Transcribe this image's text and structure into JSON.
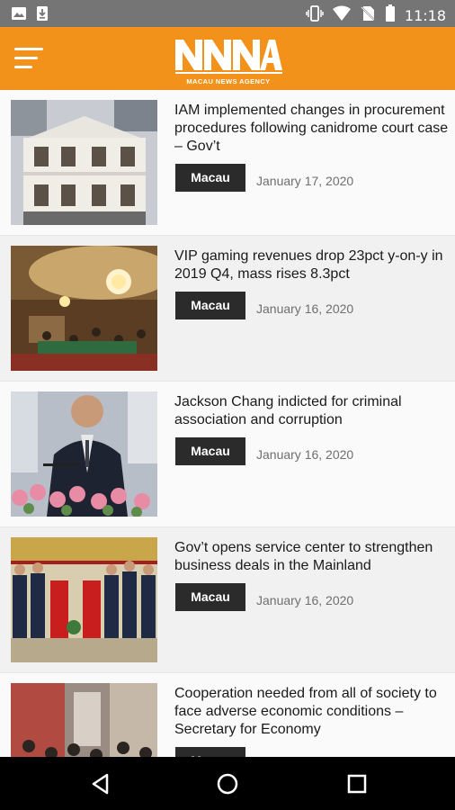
{
  "status_bar": {
    "time": "11:18",
    "left_icons": [
      "image-icon",
      "download-icon"
    ],
    "right_icons": [
      "vibrate-icon",
      "wifi-icon",
      "no-sim-icon",
      "battery-icon"
    ]
  },
  "app_bar": {
    "menu_icon": "hamburger-menu-icon",
    "logo_text": "NNNA",
    "logo_subtitle": "MACAU NEWS AGENCY",
    "accent_color": "#f2921a"
  },
  "articles": [
    {
      "headline": "IAM implemented changes in procurement procedures following canidrome court case – Gov’t",
      "tag": "Macau",
      "date": "January 17, 2020"
    },
    {
      "headline": "VIP gaming revenues drop 23pct y-on-y in 2019 Q4, mass rises 8.3pct",
      "tag": "Macau",
      "date": "January 16, 2020"
    },
    {
      "headline": "Jackson Chang indicted for criminal association and corruption",
      "tag": "Macau",
      "date": "January 16, 2020"
    },
    {
      "headline": "Gov’t opens service center to strengthen business deals in the Mainland",
      "tag": "Macau",
      "date": "January 16, 2020"
    },
    {
      "headline": "Cooperation needed from all of society to face adverse economic conditions – Secretary for Economy",
      "tag": "Macau",
      "date": ""
    }
  ],
  "nav_bar": {
    "buttons": [
      "back-icon",
      "home-icon",
      "recents-icon"
    ]
  }
}
